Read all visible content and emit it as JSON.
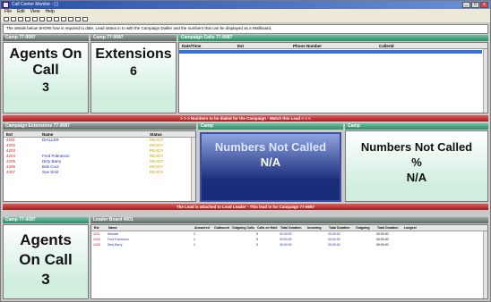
{
  "window": {
    "title": "Call Center Monitor - [ ]"
  },
  "menu": [
    "File",
    "Edit",
    "View",
    "Help"
  ],
  "message_text": "The details below SHOW how is required to date, Lead status in to with the Campaign Dialler and the numbers that can be displayed as a Wallboard.",
  "top": {
    "campaign_tab_1": "Camp 77-9087",
    "campaign_tab_2": "Camp 77-9087",
    "campaign_calls_header": "Campaign Calls 77-9087",
    "agents_on_call": {
      "title": "Agents On Call",
      "value": "3"
    },
    "extensions": {
      "title": "Extensions",
      "value": "6"
    },
    "calls_grid": {
      "columns": [
        "Date/Time",
        "Ext",
        "Phone Number",
        "CallerId"
      ]
    }
  },
  "red_bar_1": "> > > Numbers to be dialed for the Campaign - Watch this Lead < < <",
  "middle": {
    "extensions_header": "Campaign Extensions 77-9087",
    "camp_header_1": "Camp",
    "camp_header_2": "Camp",
    "ext_columns": [
      "Ext",
      "Name",
      "Status"
    ],
    "ext_rows": [
      {
        "ext": "4201",
        "name": "DIALLER",
        "status": "READY",
        "ext_color": "#d02020",
        "name_color": "#2030a0"
      },
      {
        "ext": "4202",
        "name": "",
        "status": "READY",
        "ext_color": "#d02020",
        "name_color": "#2030a0"
      },
      {
        "ext": "4203",
        "name": "",
        "status": "READY",
        "ext_color": "#d02020",
        "name_color": "#2030a0"
      },
      {
        "ext": "4204",
        "name": "Fred Fobneson",
        "status": "READY",
        "ext_color": "#d02020",
        "name_color": "#2030a0"
      },
      {
        "ext": "4205",
        "name": "Dirty Barry",
        "status": "READY",
        "ext_color": "#d02020",
        "name_color": "#2030a0"
      },
      {
        "ext": "4206",
        "name": "Bob Cool",
        "status": "READY",
        "ext_color": "#d02020",
        "name_color": "#2030a0"
      },
      {
        "ext": "4207",
        "name": "Sue Smit",
        "status": "READY",
        "ext_color": "#d02020",
        "name_color": "#2030a0"
      }
    ],
    "numbers_not_called": {
      "title": "Numbers Not Called",
      "value": "N/A"
    },
    "numbers_not_called_pct": {
      "title": "Numbers Not Called %",
      "value": "N/A"
    }
  },
  "red_bar_2": "The Lead is attached to Lead Leader - This lead is for Campaign 77-9087",
  "bottom": {
    "camp_header": "Camp 77-9087",
    "leader_board_header": "Leader Board 4001",
    "agents_on_call": {
      "title": "Agents On Call",
      "value": "3"
    },
    "leader_columns": [
      "Ext",
      "Name",
      "Answered",
      "Outbound",
      "Outgoing Calls",
      "Calls on Hold",
      "Total Duration",
      "Incoming",
      "Total Duration",
      "Outgoing",
      "Total Duration",
      "Longest"
    ],
    "leader_rows": [
      {
        "ext": "4201",
        "name": "Michael",
        "answered": "1",
        "calls": "0",
        "dur1": "00:00:00",
        "dur2": "00:00:00",
        "dur3": "00:00:00"
      },
      {
        "ext": "4204",
        "name": "Fred Fobneson",
        "answered": "1",
        "calls": "0",
        "dur1": "00:00:00",
        "dur2": "00:00:00",
        "dur3": "00:00:00"
      },
      {
        "ext": "4205",
        "name": "Dirty Barry",
        "answered": "1",
        "calls": "0",
        "dur1": "00:00:00",
        "dur2": "00:00:00",
        "dur3": "00:00:00"
      }
    ]
  },
  "colors": {
    "accent": "#2e8a66",
    "alert": "#a21f1f",
    "panel_blue": "#1a2d7a"
  }
}
